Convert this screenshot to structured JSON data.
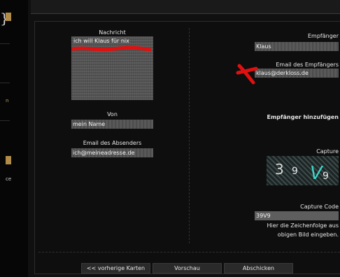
{
  "sidebar": {
    "fragment_1": "n",
    "fragment_2": "ce"
  },
  "form": {
    "message_label": "Nachricht",
    "message_value": "ich will Klaus für nix",
    "from_label": "Von",
    "from_value": "mein Name",
    "sender_email_label": "Email des Absenders",
    "sender_email_value": "ich@meineadresse.de",
    "recipient_label": "Empfänger",
    "recipient_value": "Klaus",
    "recipient_email_label": "Email des Empfängers",
    "recipient_email_value": "klaus@derkloss.de",
    "add_recipient_label": "Empfänger hinzufügen",
    "captcha_label": "Capture",
    "captcha_code_label": "Capture Code",
    "captcha_code_value": "39V9",
    "captcha_hint_line1": "Hier die Zeichenfolge aus",
    "captcha_hint_line2": "obigen Bild eingeben.",
    "captcha_image": {
      "char_1": "3",
      "char_2": "9",
      "char_3": "V",
      "char_4": "9"
    }
  },
  "buttons": {
    "previous_label": "<< vorherige Karten",
    "preview_label": "Vorschau",
    "submit_label": "Abschicken"
  },
  "colors": {
    "annotation_red": "#e01010",
    "captcha_teal": "#3fd6c8",
    "accent_gold": "#b08c46"
  }
}
